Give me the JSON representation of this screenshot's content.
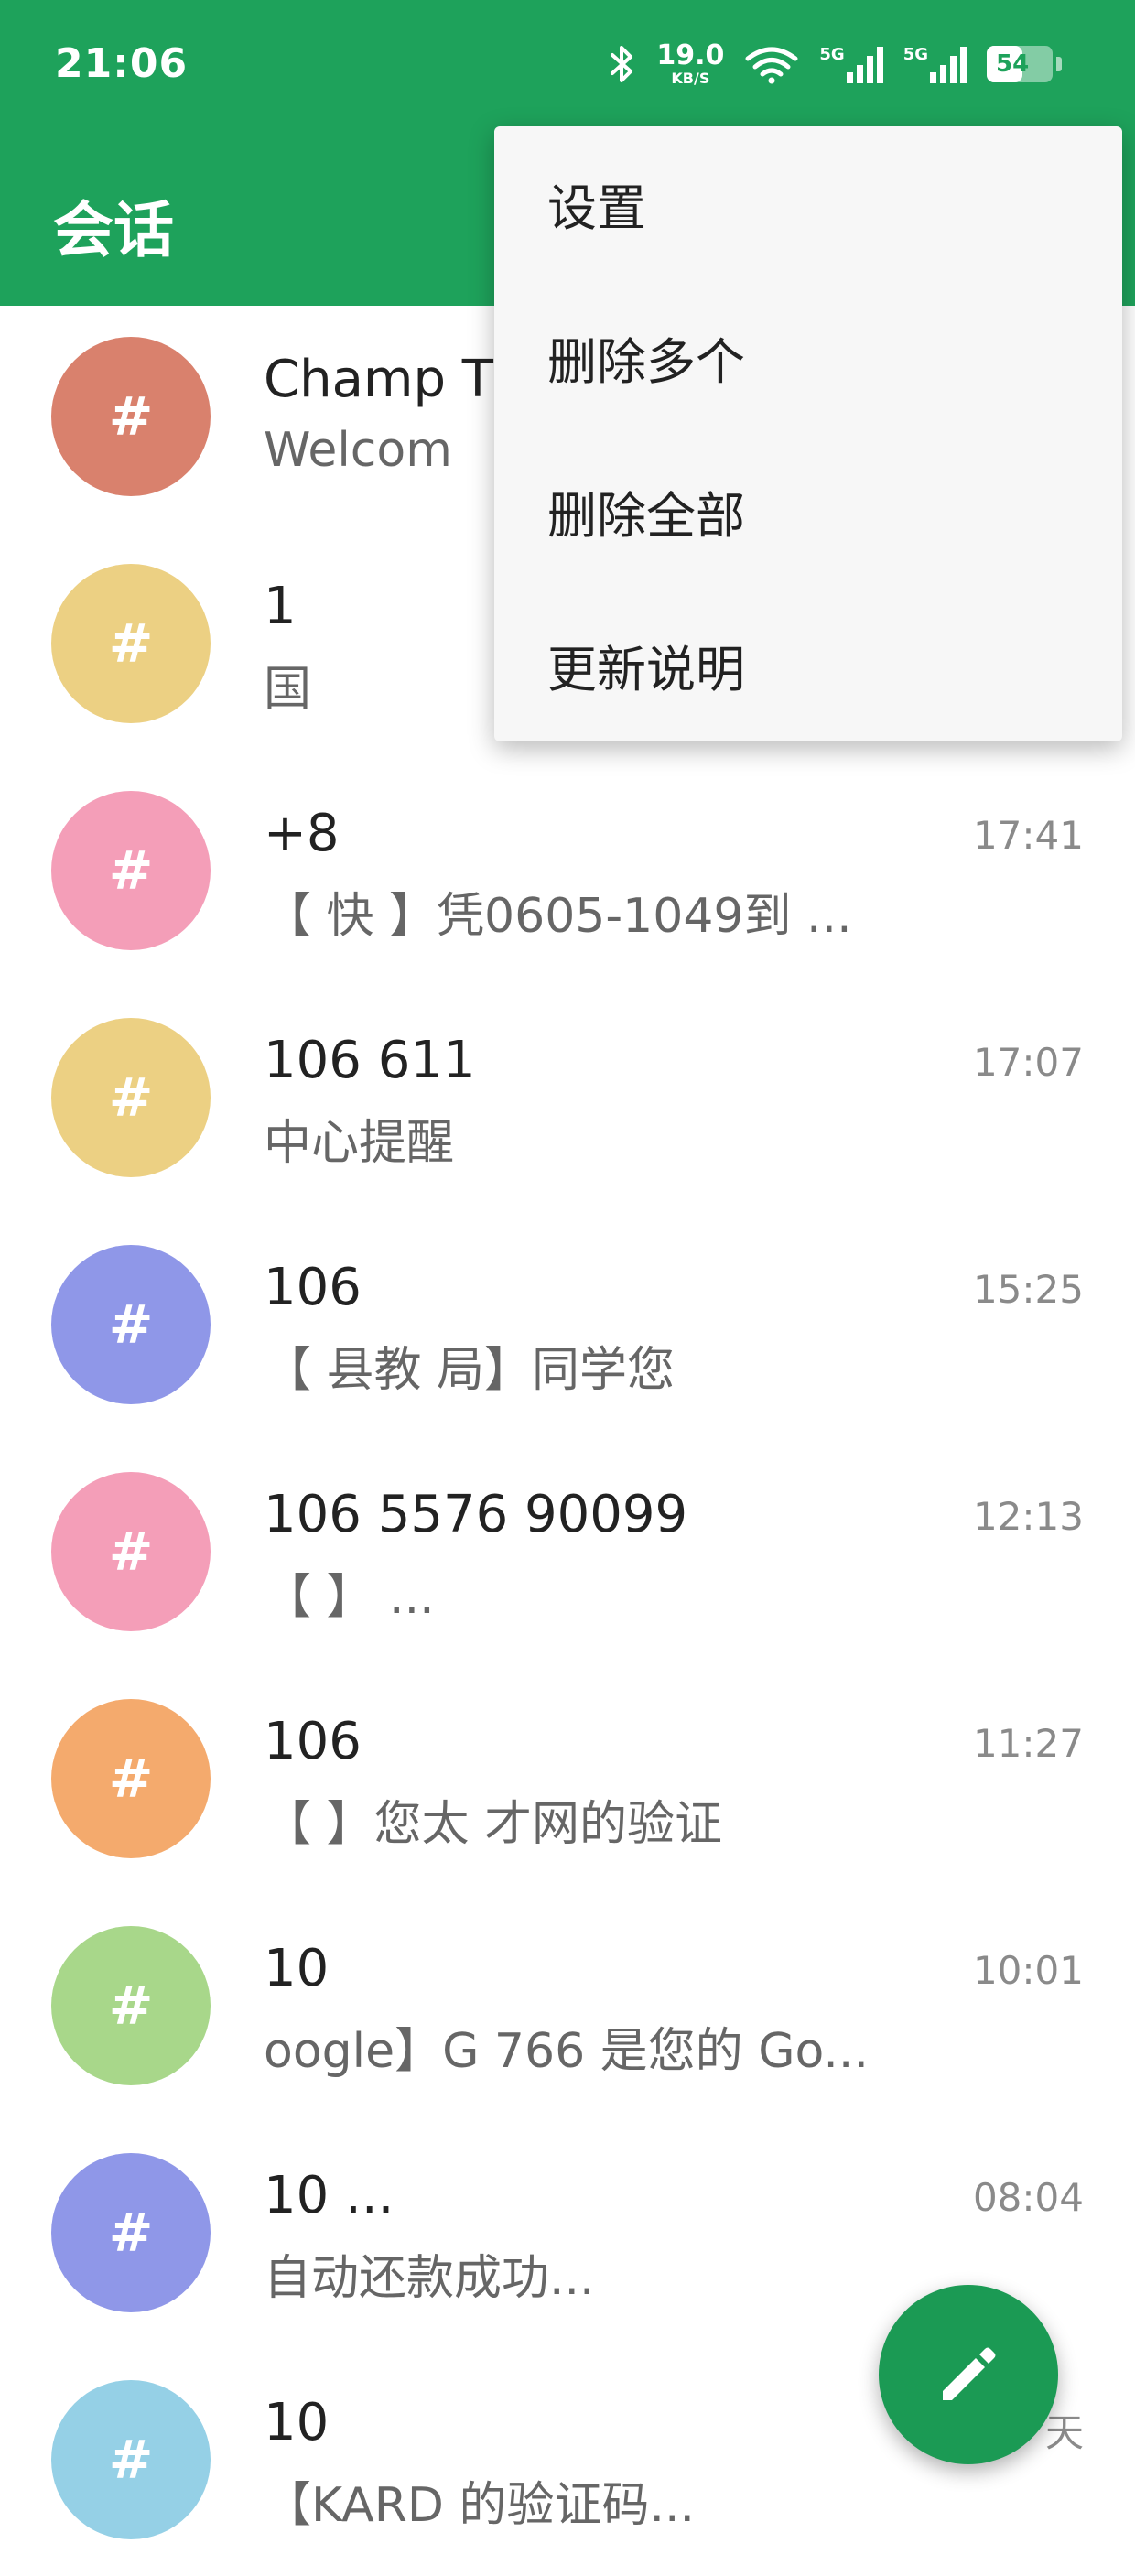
{
  "status_bar": {
    "time": "21:06",
    "net_speed": "19.0",
    "net_speed_unit": "KB/S",
    "sim1_tag": "5G",
    "sim2_tag": "5G",
    "battery": "54",
    "battery_level": 0.54
  },
  "app_bar": {
    "title": "会话"
  },
  "menu": {
    "items": [
      {
        "label": "设置"
      },
      {
        "label": "删除多个"
      },
      {
        "label": "删除全部"
      },
      {
        "label": "更新说明"
      }
    ]
  },
  "conversations": [
    {
      "avatar": "#",
      "color": "#d9816d",
      "sender": "Champ T",
      "time": "",
      "snippet": "Welcom"
    },
    {
      "avatar": "#",
      "color": "#ecd083",
      "sender": "1",
      "time": "",
      "snippet": "国"
    },
    {
      "avatar": "#",
      "color": "#f49eb8",
      "sender": "+8",
      "time": "17:41",
      "snippet": "【 快 】凭0605-1049到 ..."
    },
    {
      "avatar": "#",
      "color": "#ecd083",
      "sender": "106 611",
      "time": "17:07",
      "snippet": "中心提醒"
    },
    {
      "avatar": "#",
      "color": "#8f97e8",
      "sender": "106",
      "time": "15:25",
      "snippet": "【 县教 局】同学您"
    },
    {
      "avatar": "#",
      "color": "#f49eb8",
      "sender": "106 5576 90099",
      "time": "12:13",
      "snippet": "【 】 ..."
    },
    {
      "avatar": "#",
      "color": "#f4aa6d",
      "sender": "106",
      "time": "11:27",
      "snippet": "【 】您太  才网的验证"
    },
    {
      "avatar": "#",
      "color": "#a8d78a",
      "sender": "10",
      "time": "10:01",
      "snippet": "oogle】G  766 是您的 Go..."
    },
    {
      "avatar": "#",
      "color": "#8f97e8",
      "sender": "10 ...",
      "time": "08:04",
      "snippet": "自动还款成功..."
    },
    {
      "avatar": "#",
      "color": "#95d0e6",
      "sender": "10",
      "time": "天",
      "snippet": "【KARD  的验证码..."
    }
  ],
  "fab": {
    "icon": "pencil-icon"
  },
  "colors": {
    "primary": "#1ea25b",
    "fab": "#1b9a54"
  }
}
